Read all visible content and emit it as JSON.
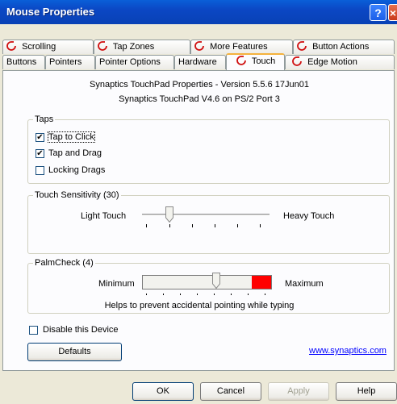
{
  "window": {
    "title": "Mouse Properties"
  },
  "tabs_row1": [
    {
      "label": "Scrolling",
      "icon": "synaptics-icon"
    },
    {
      "label": "Tap Zones",
      "icon": "synaptics-icon"
    },
    {
      "label": "More Features",
      "icon": "synaptics-icon"
    },
    {
      "label": "Button Actions",
      "icon": "synaptics-icon"
    }
  ],
  "tabs_row2": [
    {
      "label": "Buttons"
    },
    {
      "label": "Pointers"
    },
    {
      "label": "Pointer Options"
    },
    {
      "label": "Hardware"
    },
    {
      "label": "Touch",
      "icon": "synaptics-icon",
      "selected": true
    },
    {
      "label": "Edge Motion",
      "icon": "synaptics-icon"
    }
  ],
  "version": {
    "line1": "Synaptics TouchPad Properties - Version 5.5.6 17Jun01",
    "line2": "Synaptics TouchPad V4.6 on PS/2 Port 3"
  },
  "taps": {
    "label": "Taps",
    "items": [
      {
        "label": "Tap to Click",
        "checked": true
      },
      {
        "label": "Tap and Drag",
        "checked": true
      },
      {
        "label": "Locking Drags",
        "checked": false
      }
    ]
  },
  "touch_sensitivity": {
    "label": "Touch Sensitivity (30)",
    "min_label": "Light Touch",
    "max_label": "Heavy Touch",
    "value_fraction": 0.23
  },
  "palmcheck": {
    "label": "PalmCheck (4)",
    "min_label": "Minimum",
    "max_label": "Maximum",
    "hint": "Helps to prevent accidental pointing while typing",
    "value_fraction": 0.57,
    "fill_color": "#ff0000"
  },
  "disable_device": {
    "label": "Disable this Device",
    "checked": false
  },
  "defaults_button": "Defaults",
  "link": "www.synaptics.com",
  "buttons": {
    "ok": "OK",
    "cancel": "Cancel",
    "apply": "Apply",
    "help": "Help"
  },
  "colors": {
    "titlebar": "#0b47c4",
    "selected_tab_accent": "#f4b23d",
    "link": "#0000ff"
  }
}
